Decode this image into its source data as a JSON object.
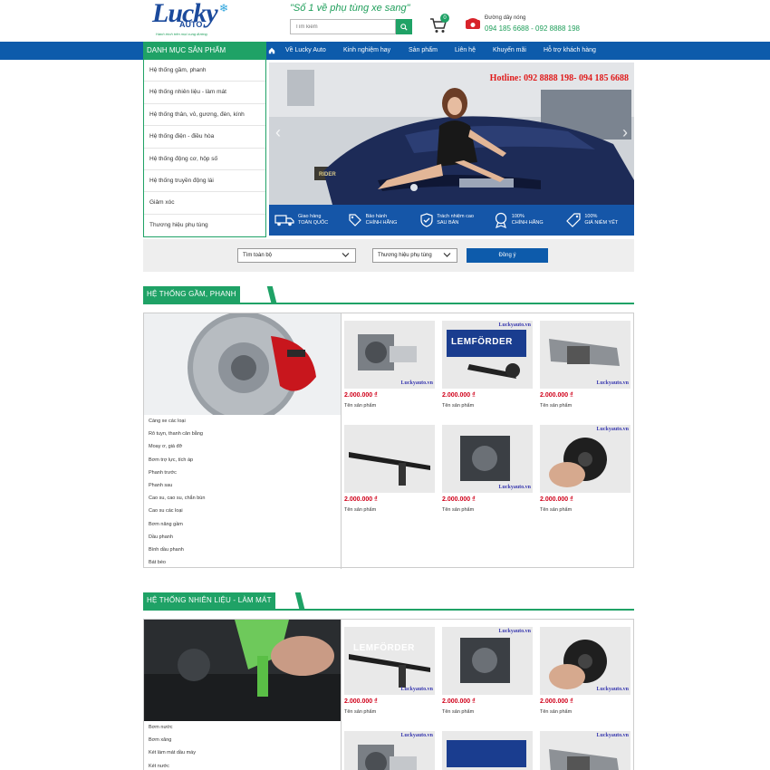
{
  "header": {
    "logo_text": "Lucky",
    "logo_sub": "AUTO",
    "logo_tagline": "Hành trình trên mọi cung đường",
    "slogan": "\"Số 1 về phụ tùng xe sang\"",
    "search_placeholder": "Tìm kiếm",
    "cart_count": "0",
    "hotline_label": "Đường dây nóng",
    "hotline_numbers": "094 185 6688 - 092 8888 198"
  },
  "nav": {
    "category_label": "DANH MỤC SẢN PHẨM",
    "items": [
      "Về Lucky Auto",
      "Kinh nghiệm hay",
      "Sản phẩm",
      "Liên hệ",
      "Khuyến mãi",
      "Hỗ trợ khách hàng"
    ]
  },
  "sidebar": {
    "items": [
      "Hệ thống gầm, phanh",
      "Hệ thống nhiên liệu - làm mát",
      "Hệ thống thân, vỏ, gương, đèn, kính",
      "Hệ thống điện - điều hòa",
      "Hệ thống động cơ, hộp số",
      "Hệ thống truyền động lái",
      "Giảm xóc",
      "Thương hiệu phụ tùng"
    ]
  },
  "banner": {
    "hotline": "Hotline: 092 8888 198- 094 185 6688",
    "garage_sign": "RIDER",
    "features": [
      {
        "line1": "Giao hàng",
        "line2": "TOÀN QUỐC",
        "icon": "truck-icon"
      },
      {
        "line1": "Bảo hành",
        "line2": "CHÍNH HÃNG",
        "icon": "tag-icon"
      },
      {
        "line1": "Trách nhiệm cao",
        "line2": "SAU BÁN",
        "icon": "shield-check-icon"
      },
      {
        "line1": "100%",
        "line2": "CHÍNH HÃNG",
        "icon": "award-icon"
      },
      {
        "line1": "100%",
        "line2": "GIÁ NIÊM YẾT",
        "icon": "price-tag-icon"
      }
    ]
  },
  "filter": {
    "select_all": "Tìm toàn bộ",
    "select_brand": "Thương hiệu phụ tùng",
    "submit": "Đồng ý"
  },
  "sections": [
    {
      "title": "HỆ THỐNG GẦM, PHANH",
      "links": [
        "Càng xe các loại",
        "Rô tuyn, thanh cân bằng",
        "Moay ơ, giá đỡ",
        "Bơm trợ lực, tích áp",
        "Phanh trước",
        "Phanh sau",
        "Cao su, cao su, chắn bùn",
        "Cao su các loại",
        "Bơm nâng gầm",
        "Dầu phanh",
        "Bình dầu phanh",
        "Bát bèo"
      ],
      "products": [
        {
          "price": "2.000.000 ₫",
          "name": "Tên sản phẩm",
          "watermark": "Luckyauto.vn"
        },
        {
          "price": "2.000.000 ₫",
          "name": "Tên sản phẩm",
          "watermark": "Luckyauto.vn",
          "brand": "LEMFÖRDER"
        },
        {
          "price": "2.000.000 ₫",
          "name": "Tên sản phẩm",
          "watermark": "Luckyauto.vn"
        },
        {
          "price": "2.000.000 ₫",
          "name": "Tên sản phẩm",
          "watermark": ""
        },
        {
          "price": "2.000.000 ₫",
          "name": "Tên sản phẩm",
          "watermark": "Luckyauto.vn"
        },
        {
          "price": "2.000.000 ₫",
          "name": "Tên sản phẩm",
          "watermark": "Luckyauto.vn"
        }
      ]
    },
    {
      "title": "HỆ THỐNG NHIÊN LIỆU - LÀM MÁT",
      "links": [
        "Bơm nước",
        "Bơm xăng",
        "Két làm mát dầu máy",
        "Két nước"
      ],
      "products": [
        {
          "price": "2.000.000 ₫",
          "name": "Tên sản phẩm",
          "watermark": "Luckyauto.vn",
          "brand": "LEMFÖRDER"
        },
        {
          "price": "2.000.000 ₫",
          "name": "Tên sản phẩm",
          "watermark": "Luckyauto.vn"
        },
        {
          "price": "2.000.000 ₫",
          "name": "Tên sản phẩm",
          "watermark": "Luckyauto.vn"
        },
        {
          "price": "",
          "name": "",
          "watermark": "Luckyauto.vn"
        },
        {
          "price": "",
          "name": "",
          "watermark": "Luckyauto.vn"
        },
        {
          "price": "",
          "name": "",
          "watermark": "Luckyauto.vn"
        }
      ]
    }
  ],
  "colors": {
    "green": "#1fa266",
    "blue": "#0d5bab",
    "price_red": "#d0021b"
  }
}
